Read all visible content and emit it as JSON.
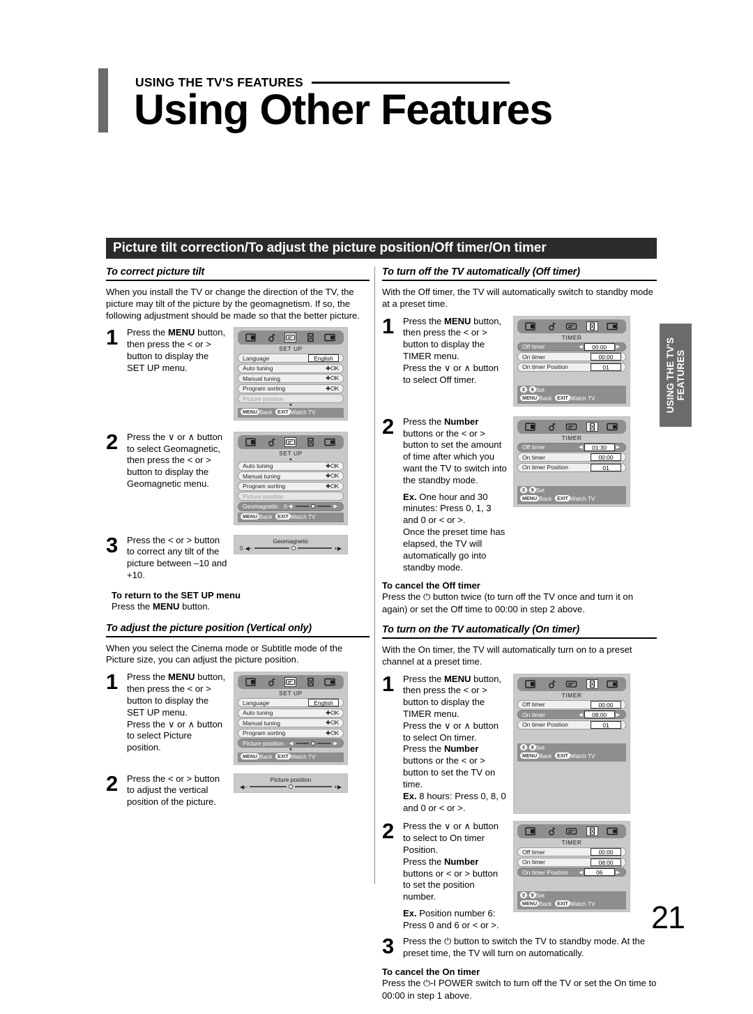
{
  "header": {
    "kicker": "USING THE TV'S FEATURES",
    "title": "Using Other Features"
  },
  "section_band": "Picture tilt correction/To adjust the picture position/Off timer/On timer",
  "side_tab": {
    "line1": "USING THE TV'S",
    "line2": "FEATURES"
  },
  "page_number": "21",
  "left_column": {
    "heading_tilt": "To correct picture tilt",
    "intro_tilt": "When you install the TV or change the direction of the TV, the picture may tilt of the picture by the geomagnetism. If so, the following adjustment should be made so that the better picture.",
    "steps": [
      {
        "num": "1",
        "text": "Press the MENU button, then press the < or > button to display the SET UP menu."
      },
      {
        "num": "2",
        "text": "Press the ∨ or ∧ button to select Geomagnetic, then press the < or > button to display the Geomagnetic menu."
      },
      {
        "num": "3",
        "text": "Press the < or > button to correct any tilt of the picture between –10 and +10."
      }
    ],
    "return_heading": "To return to the SET UP menu",
    "return_text": "Press the MENU button.",
    "heading_position": "To adjust the picture position (Vertical only)",
    "intro_position": "When you select the Cinema mode or Subtitle mode of the Picture size, you can adjust the picture position.",
    "pos_steps": [
      {
        "num": "1",
        "text": "Press the MENU button, then press the < or > button to display the SET UP menu. Press the ∨ or ∧ button to select Picture position."
      },
      {
        "num": "2",
        "text": "Press the < or > button to adjust the vertical position of the picture."
      }
    ]
  },
  "right_column": {
    "heading_off": "To turn off the TV automatically (Off timer)",
    "intro_off": "With the Off timer, the TV will automatically switch to standby mode at a preset time.",
    "off_steps": [
      {
        "num": "1",
        "text": "Press the MENU button, then press the < or > button to display the TIMER menu. Press the ∨ or ∧ button to select Off timer."
      },
      {
        "num": "2",
        "text": "Press the Number buttons or the < or > button to set the amount of time after which you want the TV to switch into the standby mode."
      }
    ],
    "off_example": "Ex. One hour and 30 minutes: Press 0, 1, 3 and 0 or < or >. Once the preset time has elapsed, the TV will automatically go into standby mode.",
    "cancel_off_heading": "To cancel the Off timer",
    "cancel_off_text": "Press the ⏻ button twice (to turn off the TV once and turn it on again) or set the Off time to 00:00 in step 2 above.",
    "heading_on": "To turn on the TV automatically (On timer)",
    "intro_on": "With the On timer, the TV will automatically turn on to a preset channel at a preset  time.",
    "on_steps": [
      {
        "num": "1",
        "text": "Press the MENU button, then press the < or > button to display the TIMER menu. Press the ∨ or ∧ button to select On timer. Press the Number buttons or the < or > button to set the TV on time."
      },
      {
        "num": "2",
        "text": "Press the ∨ or ∧ button to select to On timer Position. Press the Number buttons or < or > button to set the position number."
      },
      {
        "num": "3",
        "text": "Press the ⏻ button to switch the TV to standby mode. At the preset time, the TV will turn on automatically."
      }
    ],
    "on_example_1": "Ex. 8 hours: Press 0, 8, 0 and 0 or < or >.",
    "on_example_2": "Ex. Position number 6: Press 0 and 6 or < or >.",
    "cancel_on_heading": "To cancel the On timer",
    "cancel_on_text": "Press the ⏻-I POWER switch to turn off the TV or set the On time to 00:00 in step 1 above."
  },
  "osd": {
    "footer_menu_key": "MENU",
    "footer_back": "Back",
    "footer_exit_key": "EXIT",
    "footer_watch": "Watch TV",
    "numset_prefix": "0",
    "numset_dash": "-",
    "numset_suffix": "9",
    "numset_label": "Set",
    "ok_label": "OK",
    "title_setup": "SET UP",
    "title_timer": "TIMER",
    "labels": {
      "language": "Language",
      "auto_tuning": "Auto tuning",
      "manual_tuning": "Manual tuning",
      "program_sorting": "Program sorting",
      "picture_position": "Picture position",
      "geomagnetic": "Geomagnetic",
      "off_timer": "Off timer",
      "on_timer": "On timer",
      "on_timer_position": "On timer Position"
    },
    "values": {
      "english": "English",
      "geo_zero": "0",
      "t0000": "00:00",
      "t0130": "01:30",
      "t0800": "08:00",
      "p01": "01",
      "p06": "06"
    },
    "bars": {
      "geomagnetic_title": "Geomagnetic",
      "geomagnetic_left": "0",
      "picture_position_title": "Picture position"
    }
  }
}
